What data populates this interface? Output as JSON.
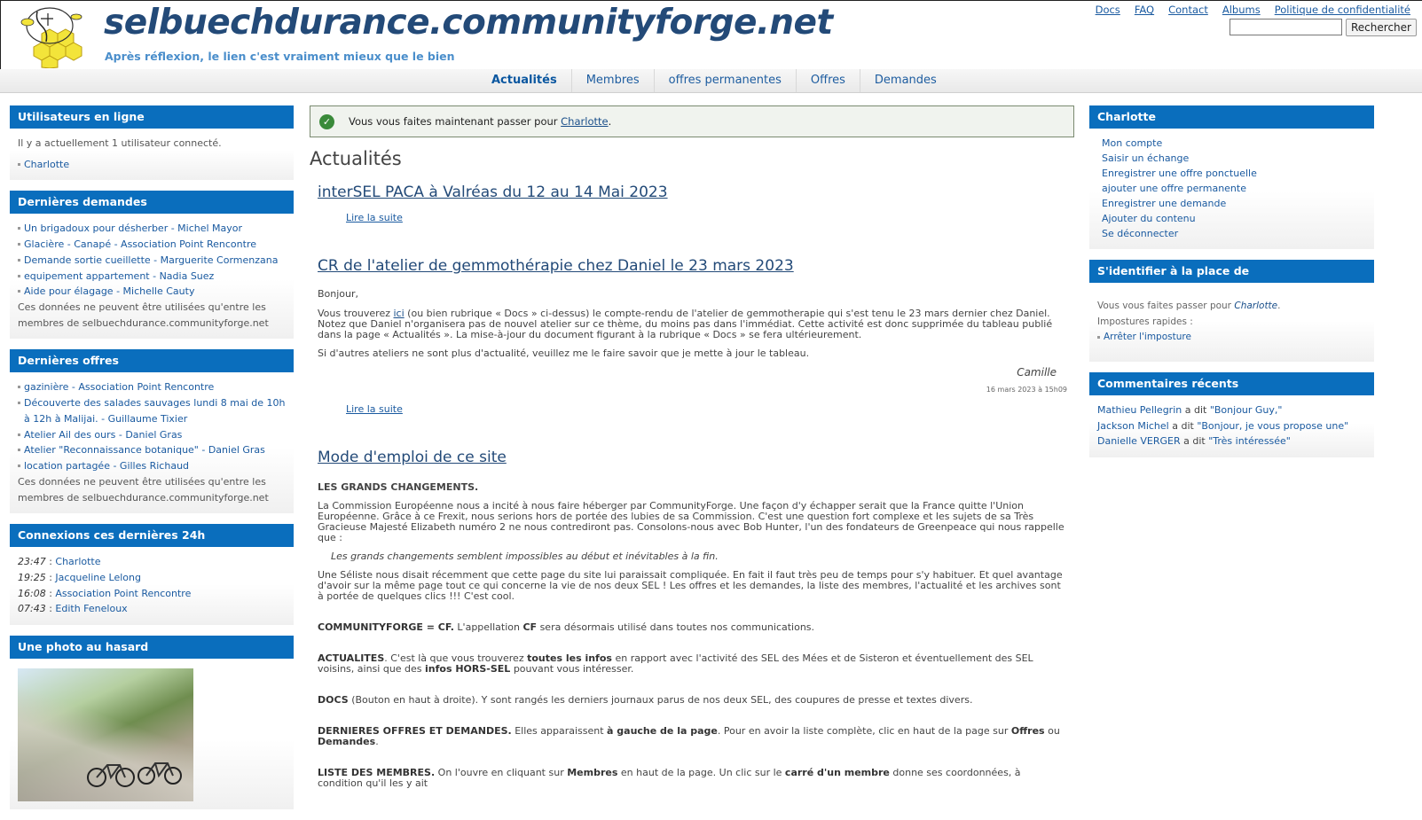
{
  "header": {
    "site_name": "selbuechdurance.communityforge.net",
    "slogan": "Après réflexion, le lien c'est vraiment mieux que le bien",
    "secondary_menu": [
      "Docs",
      "FAQ",
      "Contact",
      "Albums",
      "Politique de confidentialité"
    ],
    "search_button": "Rechercher",
    "search_value": ""
  },
  "nav": {
    "items": [
      "Actualités",
      "Membres",
      "offres permanentes",
      "Offres",
      "Demandes"
    ],
    "active": "Actualités"
  },
  "left": {
    "online": {
      "title": "Utilisateurs en ligne",
      "text": "Il y a actuellement 1 utilisateur connecté.",
      "users": [
        "Charlotte"
      ]
    },
    "demands": {
      "title": "Dernières demandes",
      "items": [
        "Un brigadoux pour désherber - Michel Mayor",
        "Glacière - Canapé - Association Point Rencontre",
        "Demande sortie cueillette - Marguerite Cormenzana",
        "equipement appartement - Nadia Suez",
        "Aide pour élagage - Michelle Cauty"
      ],
      "note": "Ces données ne peuvent être utilisées qu'entre les membres de selbuechdurance.communityforge.net"
    },
    "offers": {
      "title": "Dernières offres",
      "items": [
        "gazinière - Association Point Rencontre",
        "Découverte des salades sauvages lundi 8 mai de 10h à 12h à Malijai. - Guillaume Tixier",
        "Atelier Ail des ours - Daniel Gras",
        "Atelier \"Reconnaissance botanique\" - Daniel Gras",
        "location partagée - Gilles Richaud"
      ],
      "note": "Ces données ne peuvent être utilisées qu'entre les membres de selbuechdurance.communityforge.net"
    },
    "connections": {
      "title": "Connexions ces dernières 24h",
      "items": [
        {
          "time": "23:47",
          "name": "Charlotte"
        },
        {
          "time": "19:25",
          "name": "Jacqueline Lelong"
        },
        {
          "time": "16:08",
          "name": "Association Point Rencontre"
        },
        {
          "time": "07:43",
          "name": "Edith Feneloux"
        }
      ]
    },
    "photo": {
      "title": "Une photo au hasard"
    }
  },
  "content": {
    "status": {
      "prefix": "Vous vous faites maintenant passer pour",
      "link": "Charlotte",
      "suffix": "."
    },
    "page_title": "Actualités",
    "readmore": "Lire la suite",
    "node1": {
      "title": "interSEL PACA à Valréas du 12 au 14 Mai 2023"
    },
    "node2": {
      "title": "CR de l'atelier de gemmothérapie chez Daniel le 23 mars 2023",
      "greeting": "Bonjour,",
      "p1_a": "Vous trouverez",
      "p1_link": "ici",
      "p1_b": "(ou bien rubrique « Docs » ci-dessus) le compte-rendu de l'atelier de gemmotherapie qui s'est tenu le 23 mars dernier chez Daniel. Notez que Daniel n'organisera pas de nouvel atelier sur ce thème, du moins pas dans l'immédiat. Cette activité est donc supprimée du tableau publié dans la page « Actualités ». La mise-à-jour du document figurant à la rubrique « Docs » se fera ultérieurement.",
      "p2": "Si d'autres ateliers ne sont plus d'actualité, veuillez me le faire savoir que je mette à jour le tableau.",
      "signature": "Camille",
      "date": "16 mars 2023 à 15h09"
    },
    "node3": {
      "title": "Mode d'emploi de ce site",
      "h_changes": "LES GRANDS CHANGEMENTS.",
      "p_changes": "La Commission Européenne nous a incité à nous faire héberger par CommunityForge. Une façon d'y échapper serait que la France quitte l'Union Européenne. Grâce à ce Frexit, nous serions hors de portée des lubies de sa Commission. C'est une question fort complexe et les sujets de sa Très Gracieuse Majesté Elizabeth numéro 2 ne nous contrediront pas. Consolons-nous avec Bob Hunter, l'un des fondateurs de Greenpeace qui nous rappelle que :",
      "quote": "Les grands changements semblent impossibles au début et inévitables à la fin.",
      "p_seliste": "Une Séliste nous disait récemment que cette page du site lui paraissait compliquée. En fait il faut très peu de temps pour s'y habituer. Et quel avantage d'avoir sur la même page tout ce qui concerne la vie de nos deux SEL ! Les offres et les demandes, la liste des membres, l'actualité et les archives sont à portée de quelques clics !!! C'est cool.",
      "cf_a": "COMMUNITYFORGE = CF.",
      "cf_b": "L'appellation",
      "cf_c": "CF",
      "cf_d": "sera désormais utilisé dans toutes nos communications.",
      "act_a": "ACTUALITES",
      "act_b": ". C'est là que vous trouverez",
      "act_c": "toutes les infos",
      "act_d": "en rapport avec l'activité des SEL des Mées et de Sisteron et éventuellement des SEL voisins, ainsi que des",
      "act_e": "infos HORS-SEL",
      "act_f": "pouvant vous intéresser.",
      "docs_a": "DOCS",
      "docs_b": "(Bouton en haut à droite). Y sont rangés les derniers journaux parus de nos deux SEL, des coupures de presse et textes divers.",
      "dod_a": "DERNIERES OFFRES ET DEMANDES.",
      "dod_b": "Elles apparaissent",
      "dod_c": "à gauche de la page",
      "dod_d": ". Pour en avoir la liste complète, clic en haut de la page sur",
      "dod_e": "Offres",
      "dod_f": "ou",
      "dod_g": "Demandes",
      "dod_h": ".",
      "lm_a": "LISTE DES MEMBRES.",
      "lm_b": "On l'ouvre en cliquant sur",
      "lm_c": "Membres",
      "lm_d": "en haut de la page. Un clic sur le",
      "lm_e": "carré d'un membre",
      "lm_f": "donne ses coordonnées, à condition qu'il les y ait"
    }
  },
  "right": {
    "user": {
      "title": "Charlotte",
      "links": [
        "Mon compte",
        "Saisir un échange",
        "Enregistrer une offre ponctuelle",
        "ajouter une offre permanente",
        "Enregistrer une demande",
        "Ajouter du contenu",
        "Se déconnecter"
      ]
    },
    "masquerade": {
      "title": "S'identifier à la place de",
      "text_a": "Vous vous faites passer pour",
      "user": "Charlotte",
      "text_b": ".",
      "quick": "Impostures rapides :",
      "stop": "Arrêter l'imposture"
    },
    "comments": {
      "title": "Commentaires récents",
      "items": [
        {
          "author": "Mathieu Pellegrin",
          "said": "a dit",
          "text": "\"Bonjour Guy,\""
        },
        {
          "author": "Jackson Michel",
          "said": "a dit",
          "text": "\"Bonjour, je vous propose une\""
        },
        {
          "author": "Danielle VERGER",
          "said": "a dit",
          "text": "\"Très intéressée\""
        }
      ]
    }
  },
  "colors": {
    "brand": "#234a78",
    "block_header": "#0a6ebd",
    "link": "#1a5aa0"
  }
}
